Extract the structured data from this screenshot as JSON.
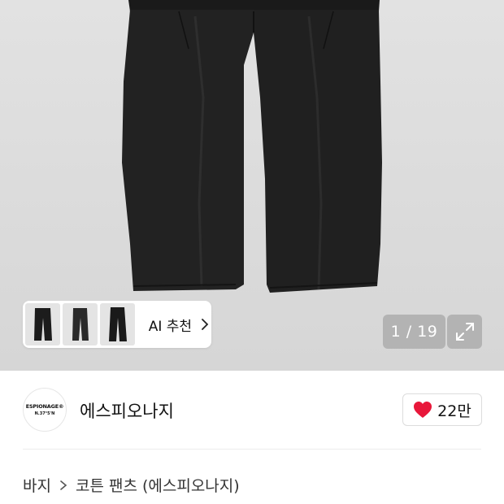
{
  "gallery": {
    "current": "1",
    "total": "19",
    "counter_text": "1 / 19",
    "ai_recommend_label": "AI 추천",
    "ai_thumbnails": [
      "pants-thumb-1",
      "pants-thumb-2",
      "pants-thumb-3"
    ]
  },
  "brand": {
    "logo_line1": "ESPIONAGE®",
    "logo_line2": "N.37°5'N",
    "name": "에스피오나지"
  },
  "like": {
    "count": "22만",
    "icon": "heart-icon",
    "color": "#e8173a"
  },
  "breadcrumb": {
    "category": "바지",
    "subcategory": "코튼 팬츠 (에스피오나지)"
  }
}
